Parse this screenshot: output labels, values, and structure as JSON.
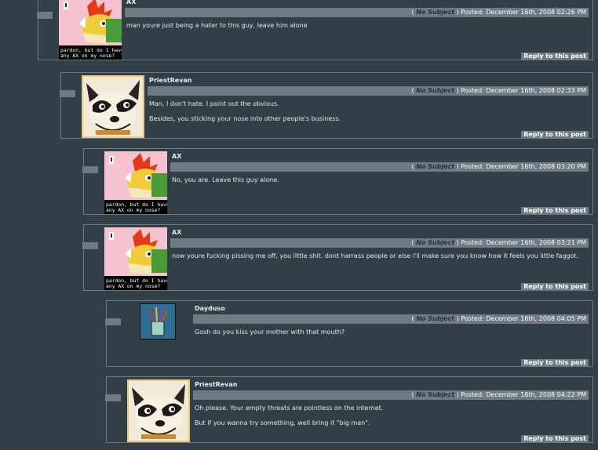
{
  "labels": {
    "reply": "Reply to this post",
    "posted": "Posted:",
    "open_paren": "(",
    "close_paren": ")"
  },
  "avatars": {
    "ax_caption": [
      "pardon, but do I have",
      "any AX on my nose?"
    ]
  },
  "posts": [
    {
      "author": "AX",
      "subject": "No Subject",
      "date": "December 16th, 2008 02:26 PM",
      "body": [
        "man youre just being a hater to this guy, leave him alone"
      ]
    },
    {
      "author": "PriestRevan",
      "subject": "No Subject",
      "date": "December 16th, 2008 02:33 PM",
      "body": [
        "Man, I don't hate. I point out the obvious.",
        "Besides, you sticking your nose into other people's business."
      ]
    },
    {
      "author": "AX",
      "subject": "No Subject",
      "date": "December 16th, 2008 03:20 PM",
      "body": [
        "No, you are. Leave this guy alone."
      ]
    },
    {
      "author": "AX",
      "subject": "No Subject",
      "date": "December 16th, 2008 03:21 PM",
      "body": [
        "now youre fucking pissing me off, you little shit. dont harrass people or else i'll make sure you know how it feels you little faggot."
      ]
    },
    {
      "author": "Dayduso",
      "subject": "No Subject",
      "date": "December 16th, 2008 04:05 PM",
      "body": [
        "Gosh do you kiss your mother with that mouth?"
      ]
    },
    {
      "author": "PriestRevan",
      "subject": "No Subject",
      "date": "December 16th, 2008 04:22 PM",
      "body": [
        "Oh please. Your empty threats are pointless on the internet.",
        "But if you wanna try something, well bring it \"big man\"."
      ]
    }
  ]
}
